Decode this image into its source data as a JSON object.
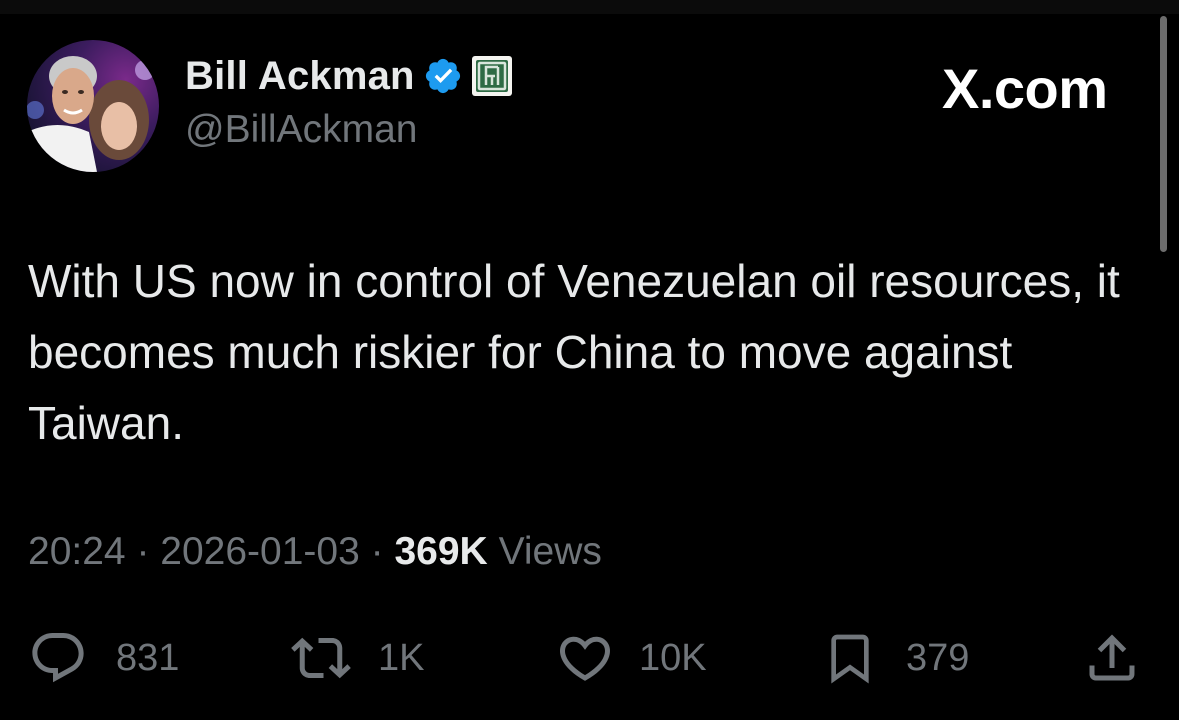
{
  "author": {
    "display_name": "Bill Ackman",
    "handle": "@BillAckman",
    "verified": true
  },
  "brand": "X.com",
  "tweet": {
    "text": "With US now in control of Venezuelan oil resources, it becomes much riskier for China to move against Taiwan."
  },
  "meta": {
    "time": "20:24",
    "separator": "·",
    "date": "2026-01-03",
    "views_count": "369K",
    "views_label": "Views"
  },
  "actions": {
    "replies": "831",
    "reposts": "1K",
    "likes": "10K",
    "bookmarks": "379"
  },
  "colors": {
    "background": "#000000",
    "text": "#e7e9ea",
    "muted": "#71767b",
    "verified_blue": "#1d9bf0",
    "affiliate_green": "#2e6b45"
  },
  "icons": {
    "verified": "verified-badge-icon",
    "affiliate": "affiliate-badge-icon",
    "reply": "reply-icon",
    "repost": "repost-icon",
    "like": "heart-icon",
    "bookmark": "bookmark-icon",
    "share": "share-icon"
  }
}
